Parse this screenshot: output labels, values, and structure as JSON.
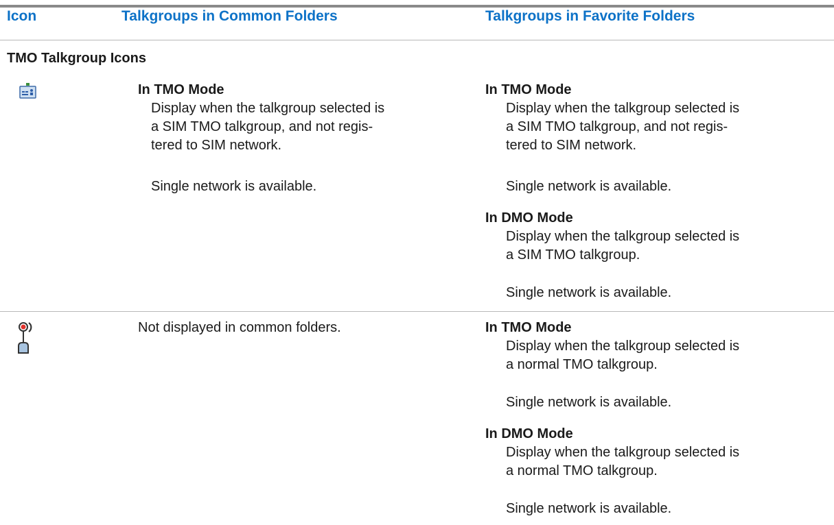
{
  "table": {
    "headers": {
      "icon": "Icon",
      "common": "Talkgroups in Common Folders",
      "favorite": "Talkgroups in Favorite Folders"
    },
    "section_title": "TMO Talkgroup Icons",
    "rows": [
      {
        "icon": "sim-tmo-talkgroup-icon",
        "common": {
          "mode": "In TMO Mode",
          "lines": [
            "Display when the talkgroup selected is",
            "a SIM TMO talkgroup, and not regis-",
            "tered to SIM network."
          ],
          "note": "Single network is available."
        },
        "favorite": [
          {
            "mode": "In TMO Mode",
            "lines": [
              "Display when the talkgroup selected is",
              "a SIM TMO talkgroup, and not regis-",
              "tered to SIM network."
            ],
            "note": "Single network is available."
          },
          {
            "mode": "In DMO Mode",
            "lines": [
              "Display when the talkgroup selected is",
              "a SIM TMO talkgroup."
            ],
            "note": "Single network is available."
          }
        ]
      },
      {
        "icon": "normal-tmo-talkgroup-icon",
        "common": {
          "text": "Not displayed in common folders."
        },
        "favorite": [
          {
            "mode": "In TMO Mode",
            "lines": [
              "Display when the talkgroup selected is",
              "a normal TMO talkgroup."
            ],
            "note": "Single network is available."
          },
          {
            "mode": "In DMO Mode",
            "lines": [
              "Display when the talkgroup selected is",
              "a normal TMO talkgroup."
            ],
            "note": "Single network is available."
          }
        ]
      }
    ]
  },
  "colors": {
    "header_text": "#0d72c7",
    "body_text": "#1a1a1a",
    "rule": "#b8b8b8",
    "top_rule": "#8a8a8a"
  }
}
